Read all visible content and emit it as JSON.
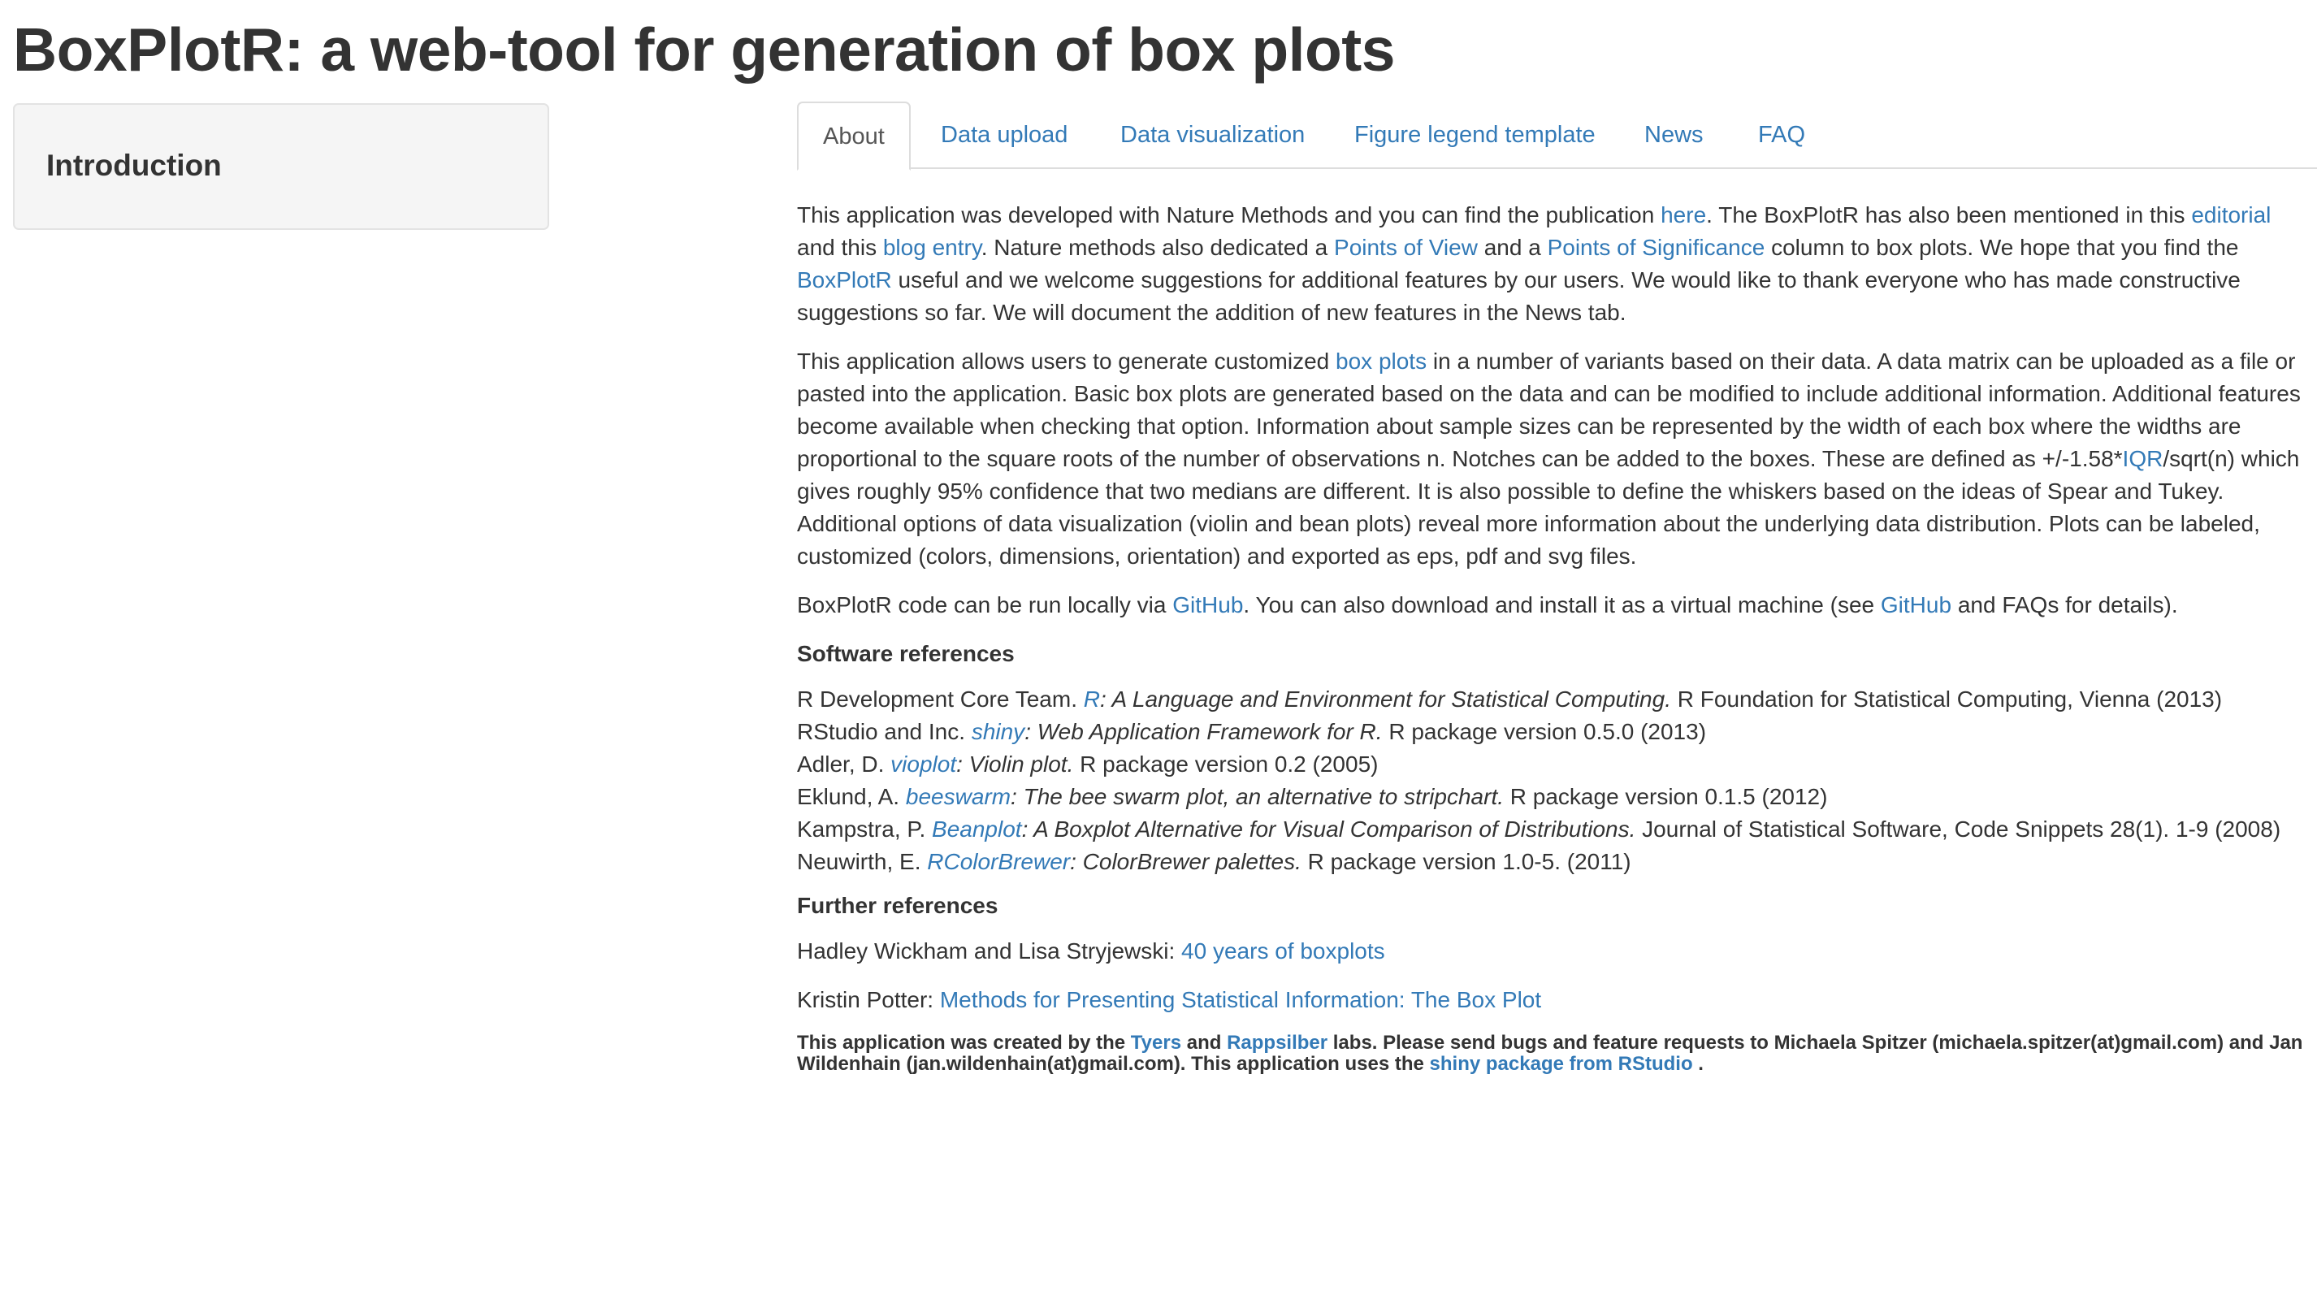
{
  "page": {
    "title": "BoxPlotR: a web-tool for generation of box plots"
  },
  "sidebar": {
    "heading": "Introduction"
  },
  "tabs": [
    {
      "label": "About",
      "active": true
    },
    {
      "label": "Data upload",
      "active": false
    },
    {
      "label": "Data visualization",
      "active": false
    },
    {
      "label": "Figure legend template",
      "active": false
    },
    {
      "label": "News",
      "active": false
    },
    {
      "label": "FAQ",
      "active": false
    }
  ],
  "about": {
    "p1": {
      "t1": "This application was developed with Nature Methods and you can find the publication ",
      "l_here": "here",
      "t2": ". The BoxPlotR has also been mentioned in this ",
      "l_editorial": "editorial",
      "t3": " and this ",
      "l_blog": "blog entry",
      "t4": ". Nature methods also dedicated a ",
      "l_pov": "Points of View",
      "t5": " and a ",
      "l_pos": "Points of Significance",
      "t6": " column to box plots. We hope that you find the ",
      "l_boxplotr": "BoxPlotR",
      "t7": " useful and we welcome suggestions for additional features by our users. We would like to thank everyone who has made constructive suggestions so far. We will document the addition of new features in the News tab."
    },
    "p2": {
      "t1": "This application allows users to generate customized ",
      "l_boxplots": "box plots",
      "t2": " in a number of variants based on their data. A data matrix can be uploaded as a file or pasted into the application. Basic box plots are generated based on the data and can be modified to include additional information. Additional features become available when checking that option. Information about sample sizes can be represented by the width of each box where the widths are proportional to the square roots of the number of observations n. Notches can be added to the boxes. These are defined as +/-1.58*",
      "l_iqr": "IQR",
      "t3": "/sqrt(n) which gives roughly 95% confidence that two medians are different. It is also possible to define the whiskers based on the ideas of Spear and Tukey. Additional options of data visualization (violin and bean plots) reveal more information about the underlying data distribution. Plots can be labeled, customized (colors, dimensions, orientation) and exported as eps, pdf and svg files."
    },
    "p3": {
      "t1": "BoxPlotR code can be run locally via ",
      "l_github1": "GitHub",
      "t2": ". You can also download and install it as a virtual machine (see ",
      "l_github2": "GitHub",
      "t3": " and FAQs for details)."
    },
    "software_heading": "Software references",
    "software_refs": [
      {
        "pre": "R Development Core Team. ",
        "link": "R",
        "title": ": A Language and Environment for Statistical Computing.",
        "post": " R Foundation for Statistical Computing, Vienna (2013)"
      },
      {
        "pre": "RStudio and Inc. ",
        "link": "shiny",
        "title": ": Web Application Framework for R.",
        "post": " R package version 0.5.0 (2013)"
      },
      {
        "pre": "Adler, D. ",
        "link": "vioplot",
        "title": ": Violin plot.",
        "post": " R package version 0.2 (2005)"
      },
      {
        "pre": "Eklund, A. ",
        "link": "beeswarm",
        "title": ": The bee swarm plot, an alternative to stripchart.",
        "post": " R package version 0.1.5 (2012)"
      },
      {
        "pre": "Kampstra, P. ",
        "link": "Beanplot",
        "title": ": A Boxplot Alternative for Visual Comparison of Distributions.",
        "post": " Journal of Statistical Software, Code Snippets 28(1). 1-9 (2008)"
      },
      {
        "pre": "Neuwirth, E. ",
        "link": "RColorBrewer",
        "title": ": ColorBrewer palettes.",
        "post": " R package version 1.0-5. (2011)"
      }
    ],
    "further_heading": "Further references",
    "further": {
      "f1_pre": "Hadley Wickham and Lisa Stryjewski: ",
      "f1_link": "40 years of boxplots",
      "f2_pre": "Kristin Potter: ",
      "f2_link": "Methods for Presenting Statistical Information: The Box Plot"
    },
    "footer": {
      "t1": "This application was created by the ",
      "l_tyers": "Tyers",
      "t2": " and ",
      "l_rapp": "Rappsilber",
      "t3": " labs. Please send bugs and feature requests to Michaela Spitzer (michaela.spitzer(at)gmail.com) and Jan Wildenhain (jan.wildenhain(at)gmail.com). This application uses the ",
      "l_shiny": "shiny package from RStudio",
      "t4": " ."
    }
  }
}
